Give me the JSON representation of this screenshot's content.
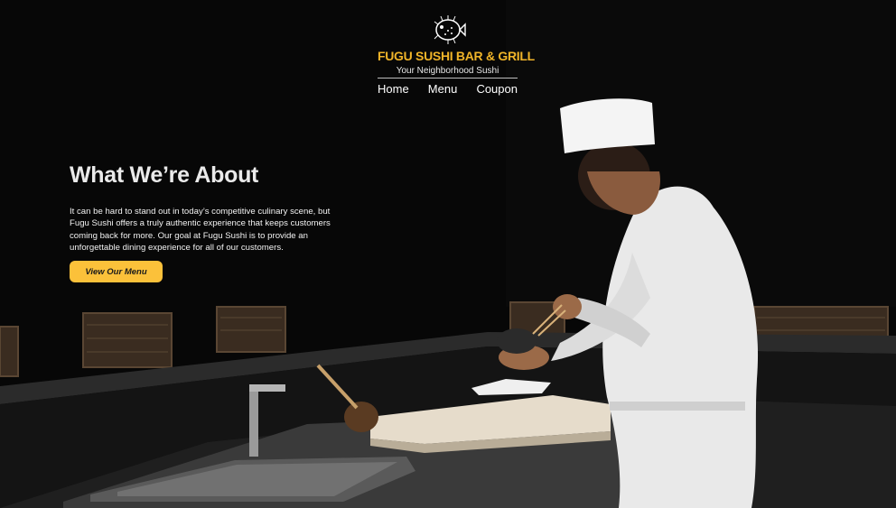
{
  "site": {
    "name": "FUGU SUSHI BAR & GRILL",
    "tagline": "Your Neighborhood Sushi",
    "logo_icon": "pufferfish-icon",
    "brand_color": "#f0b429"
  },
  "nav": {
    "items": [
      "Home",
      "Menu",
      "Coupon"
    ]
  },
  "about": {
    "heading": "What We’re About",
    "body": "It can be hard to stand out in today’s competitive culinary scene, but Fugu Sushi offers a truly authentic experience that keeps customers coming back for more. Our goal at Fugu Sushi is to provide an unforgettable dining experience for all of our customers."
  },
  "cta": {
    "label": "View Our Menu",
    "color": "#fbc13a"
  },
  "hero_image": {
    "subject": "chef-at-sushi-counter"
  }
}
